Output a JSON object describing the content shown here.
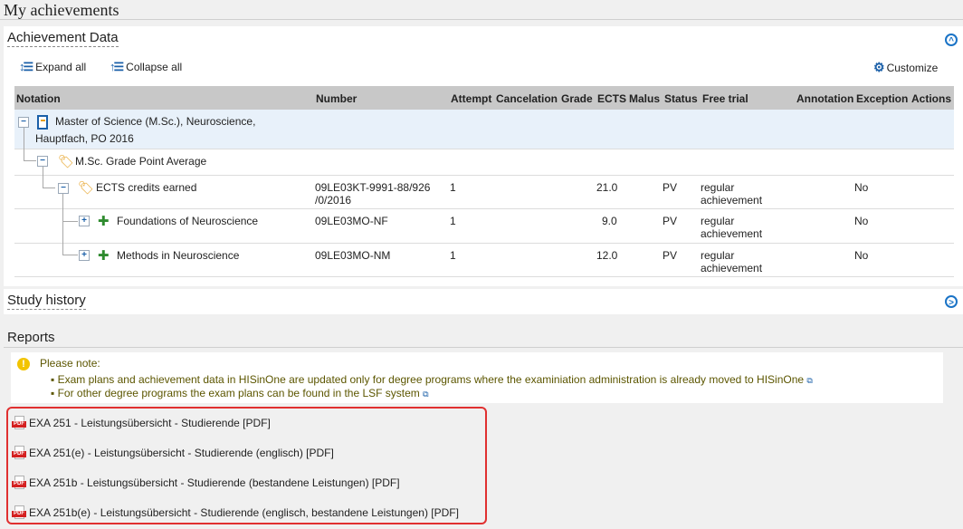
{
  "page": {
    "title": "My achievements"
  },
  "achievement_panel": {
    "title": "Achievement Data",
    "expand_all": "Expand all",
    "collapse_all": "Collapse all",
    "customize": "Customize",
    "collapse_icon": "chevron-up-circle-icon"
  },
  "table": {
    "columns": [
      "Notation",
      "Number",
      "Attempt",
      "Cancelation",
      "Grade",
      "ECTS",
      "Malus",
      "Status",
      "Free trial",
      "Annotation",
      "Exception",
      "Actions"
    ],
    "rows": [
      {
        "notation": "Master of Science (M.Sc.), Neuroscience, Hauptfach, PO 2016",
        "icon": "degree-document-icon",
        "number": "",
        "attempt": "",
        "ects": "",
        "status": "",
        "free_trial": "",
        "exception": ""
      },
      {
        "notation": "M.Sc. Grade Point Average",
        "icon": "tag-icon",
        "number": "",
        "attempt": "",
        "ects": "",
        "status": "",
        "free_trial": "",
        "exception": ""
      },
      {
        "notation": "ECTS credits earned",
        "icon": "tag-icon",
        "number": "09LE03KT-9991-88/926/0/2016",
        "number_line1": "09LE03KT-9991-88/926",
        "number_line2": "/0/2016",
        "attempt": "1",
        "ects": "21.0",
        "status": "PV",
        "free_trial_line1": "regular",
        "free_trial_line2": "achievement",
        "exception": "No"
      },
      {
        "notation": "Foundations of Neuroscience",
        "icon": "puzzle-module-icon",
        "number": "09LE03MO-NF",
        "attempt": "1",
        "ects": "9.0",
        "status": "PV",
        "free_trial_line1": "regular",
        "free_trial_line2": "achievement",
        "exception": "No"
      },
      {
        "notation": "Methods in Neuroscience",
        "icon": "puzzle-module-icon",
        "number": "09LE03MO-NM",
        "attempt": "1",
        "ects": "12.0",
        "status": "PV",
        "free_trial_line1": "regular",
        "free_trial_line2": "achievement",
        "exception": "No"
      }
    ]
  },
  "study_history": {
    "title": "Study history",
    "expand_icon": "chevron-right-circle-icon"
  },
  "reports": {
    "title": "Reports",
    "note_title": "Please note:",
    "note_lines": [
      "Exam plans and achievement data in HISinOne are updated only for degree programs where the examiniation administration is already moved to HISinOne",
      "For other degree programs the exam plans can be found in the LSF system"
    ],
    "items": [
      "EXA 251 - Leistungsübersicht - Studierende [PDF]",
      "EXA 251(e) - Leistungsübersicht - Studierende (englisch) [PDF]",
      "EXA 251b - Leistungsübersicht - Studierende (bestandene Leistungen) [PDF]",
      "EXA 251b(e) - Leistungsübersicht - Studierende (englisch, bestandene Leistungen) [PDF]"
    ],
    "highlight_color": "#e03030"
  },
  "colors": {
    "accent": "#1a73c6",
    "header_bg": "#c8c8c8",
    "selected_row": "#e8f1fa",
    "note_text": "#5c5600"
  }
}
